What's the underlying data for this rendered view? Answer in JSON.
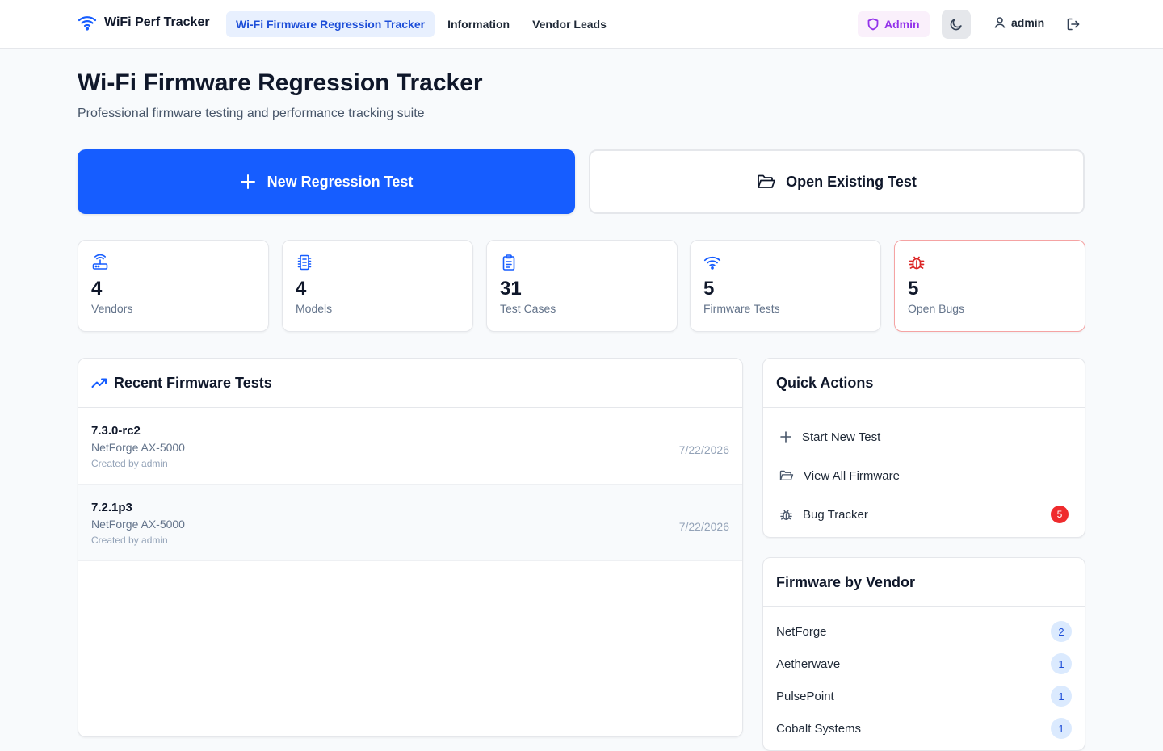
{
  "app": {
    "brand": "WiFi Perf Tracker"
  },
  "nav": {
    "items": [
      {
        "label": "Wi-Fi Firmware Regression Tracker",
        "active": true
      },
      {
        "label": "Information",
        "active": false
      },
      {
        "label": "Vendor Leads",
        "active": false
      }
    ]
  },
  "header_right": {
    "role": "Admin",
    "user": "admin"
  },
  "page": {
    "title": "Wi-Fi Firmware Regression Tracker",
    "subtitle": "Professional firmware testing and performance tracking suite"
  },
  "actions": {
    "new_test": "New Regression Test",
    "open_test": "Open Existing Test"
  },
  "stats": [
    {
      "value": "4",
      "label": "Vendors",
      "icon": "router-icon"
    },
    {
      "value": "4",
      "label": "Models",
      "icon": "chip-icon"
    },
    {
      "value": "31",
      "label": "Test Cases",
      "icon": "clipboard-icon"
    },
    {
      "value": "5",
      "label": "Firmware Tests",
      "icon": "wifi-icon"
    },
    {
      "value": "5",
      "label": "Open Bugs",
      "icon": "bug-icon"
    }
  ],
  "recent": {
    "title": "Recent Firmware Tests",
    "rows": [
      {
        "version": "7.3.0-rc2",
        "model": "NetForge AX-5000",
        "created_by": "Created by admin",
        "date": "7/22/2026"
      },
      {
        "version": "7.2.1p3",
        "model": "NetForge AX-5000",
        "created_by": "Created by admin",
        "date": "7/22/2026"
      }
    ]
  },
  "quick_actions": {
    "title": "Quick Actions",
    "items": [
      {
        "label": "Start New Test",
        "icon": "plus-icon"
      },
      {
        "label": "View All Firmware",
        "icon": "folder-icon"
      },
      {
        "label": "Bug Tracker",
        "icon": "bug-icon",
        "badge": "5"
      }
    ]
  },
  "firmware_by_vendor": {
    "title": "Firmware by Vendor",
    "items": [
      {
        "name": "NetForge",
        "count": "2"
      },
      {
        "name": "Aetherwave",
        "count": "1"
      },
      {
        "name": "PulsePoint",
        "count": "1"
      },
      {
        "name": "Cobalt Systems",
        "count": "1"
      }
    ]
  },
  "colors": {
    "primary": "#165dff",
    "danger": "#ef2b2d",
    "admin": "#9333ea"
  }
}
